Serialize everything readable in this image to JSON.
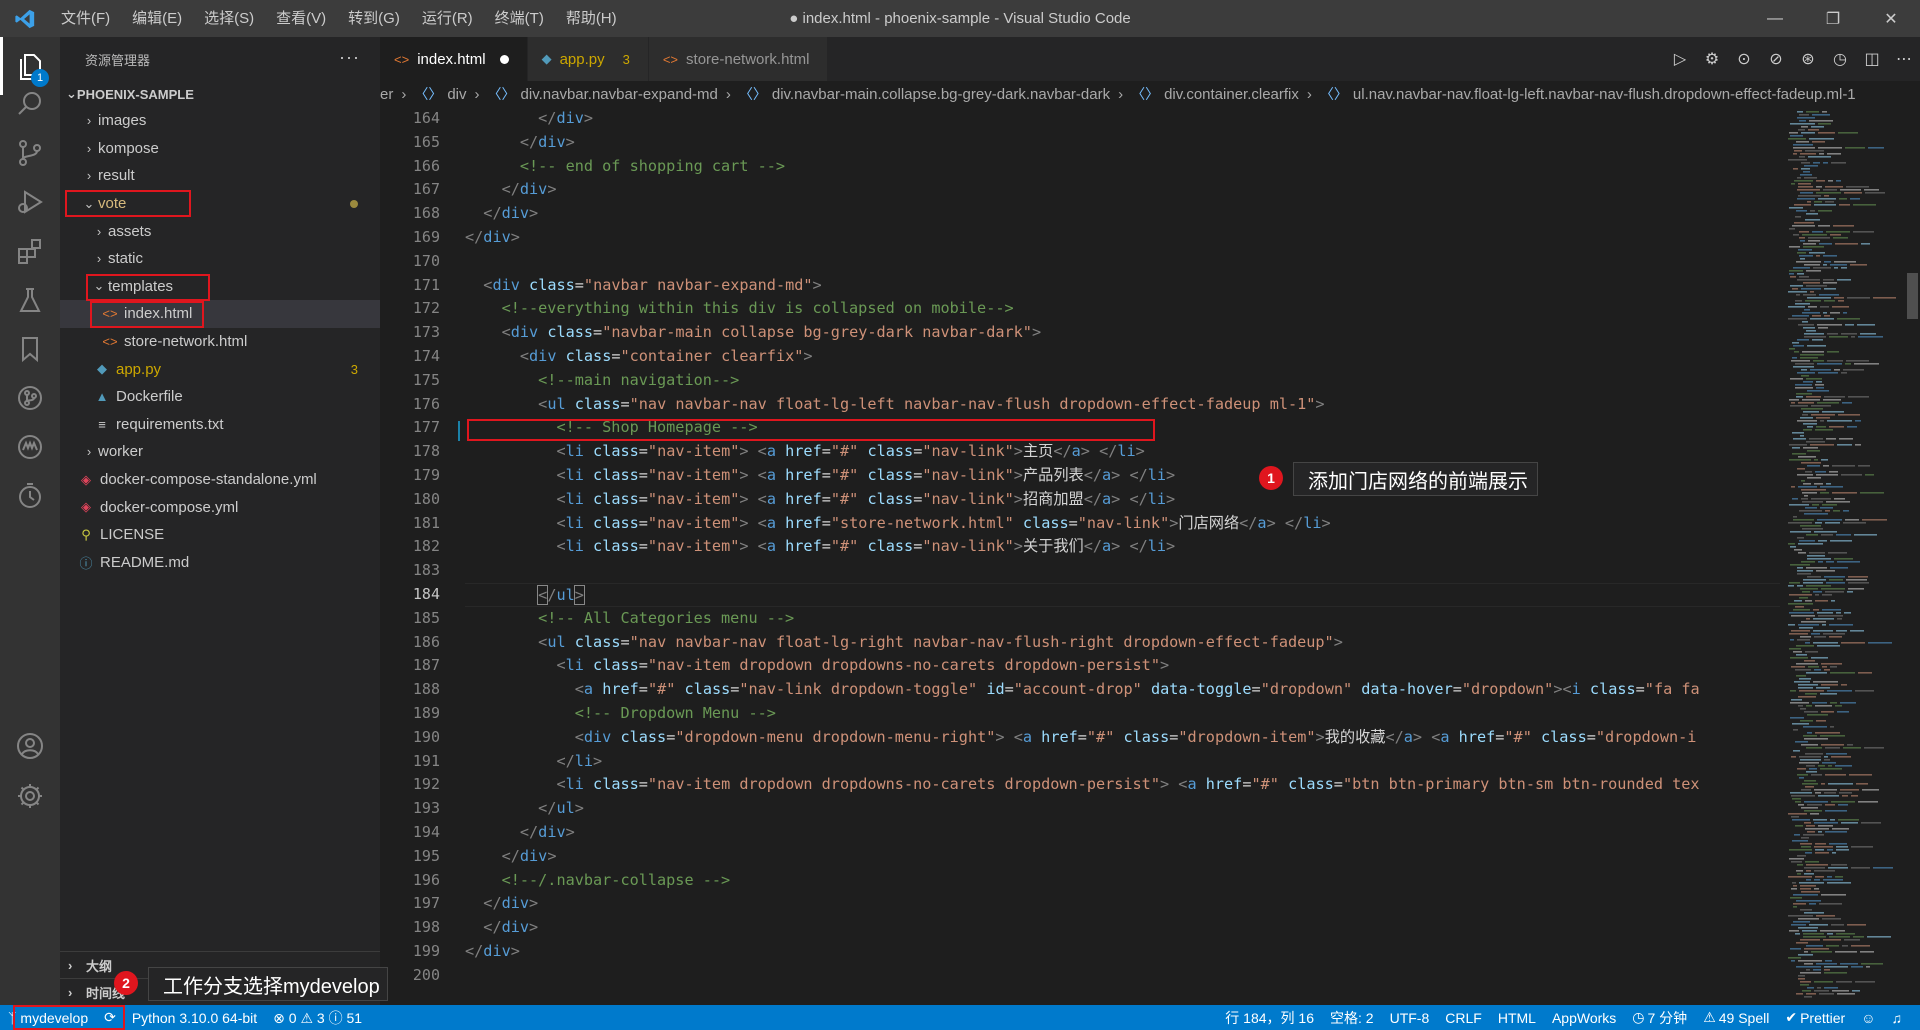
{
  "titlebar": {
    "menu": [
      "文件(F)",
      "编辑(E)",
      "选择(S)",
      "查看(V)",
      "转到(G)",
      "运行(R)",
      "终端(T)",
      "帮助(H)"
    ],
    "title": "● index.html - phoenix-sample - Visual Studio Code"
  },
  "activitybar": {
    "explorer_badge": "1",
    "icons": [
      "files-icon",
      "search-icon",
      "source-control-icon",
      "run-debug-icon",
      "extensions-icon",
      "testing-icon",
      "bookmarks-icon",
      "git-graph-icon",
      "appworks-icon",
      "timeline-icon",
      "account-icon",
      "settings-gear-icon"
    ]
  },
  "sidebar": {
    "title": "资源管理器",
    "more": "···",
    "project": "PHOENIX-SAMPLE",
    "tree": [
      {
        "label": "images",
        "type": "folder",
        "open": false
      },
      {
        "label": "kompose",
        "type": "folder",
        "open": false
      },
      {
        "label": "result",
        "type": "folder",
        "open": false
      },
      {
        "label": "vote",
        "type": "folder",
        "open": true
      },
      {
        "label": "assets",
        "type": "folder",
        "open": false
      },
      {
        "label": "static",
        "type": "folder",
        "open": false
      },
      {
        "label": "templates",
        "type": "folder",
        "open": true
      },
      {
        "label": "index.html",
        "type": "html"
      },
      {
        "label": "store-network.html",
        "type": "html"
      },
      {
        "label": "app.py",
        "type": "python",
        "count": "3"
      },
      {
        "label": "Dockerfile",
        "type": "docker"
      },
      {
        "label": "requirements.txt",
        "type": "text"
      },
      {
        "label": "worker",
        "type": "folder",
        "open": false
      },
      {
        "label": "docker-compose-standalone.yml",
        "type": "yaml"
      },
      {
        "label": "docker-compose.yml",
        "type": "yaml"
      },
      {
        "label": "LICENSE",
        "type": "license"
      },
      {
        "label": "README.md",
        "type": "info"
      }
    ],
    "outline": "大纲",
    "timeline": "时间线"
  },
  "tabs": [
    {
      "label": "index.html",
      "modified": true,
      "active": true
    },
    {
      "label": "app.py",
      "count": "3"
    },
    {
      "label": "store-network.html"
    }
  ],
  "breadcrumb": [
    "er",
    "div",
    "div.navbar.navbar-expand-md",
    "div.navbar-main.collapse.bg-grey-dark.navbar-dark",
    "div.container.clearfix",
    "ul.nav.navbar-nav.float-lg-left.navbar-nav-flush.dropdown-effect-fadeup.ml-1"
  ],
  "editor": {
    "line_numbers": [
      "164",
      "165",
      "166",
      "167",
      "168",
      "169",
      "170",
      "171",
      "172",
      "173",
      "174",
      "175",
      "176",
      "177",
      "178",
      "179",
      "180",
      "181",
      "182",
      "183",
      "184",
      "185",
      "186",
      "187",
      "188",
      "189",
      "190",
      "191",
      "192",
      "193",
      "194",
      "195",
      "196",
      "197",
      "198",
      "199",
      "200"
    ],
    "current_line": "184"
  },
  "annotations": {
    "callout1_num": "1",
    "callout1_text": "添加门店网络的前端展示",
    "callout2_num": "2",
    "callout2_text": "工作分支选择mydevelop"
  },
  "statusbar": {
    "branch": "mydevelop",
    "python": "Python 3.10.0 64-bit",
    "problems": "⊗ 0 ⚠ 3 ⓘ 51",
    "position": "行 184，列 16",
    "spaces": "空格: 2",
    "encoding": "UTF-8",
    "eol": "CRLF",
    "language": "HTML",
    "appworks": "AppWorks",
    "time": "7 分钟",
    "spell": "49 Spell",
    "prettier": "Prettier"
  },
  "colors": {
    "accent": "#007acc",
    "annotation": "#e0161e",
    "editor_bg": "#1e1e1e"
  }
}
